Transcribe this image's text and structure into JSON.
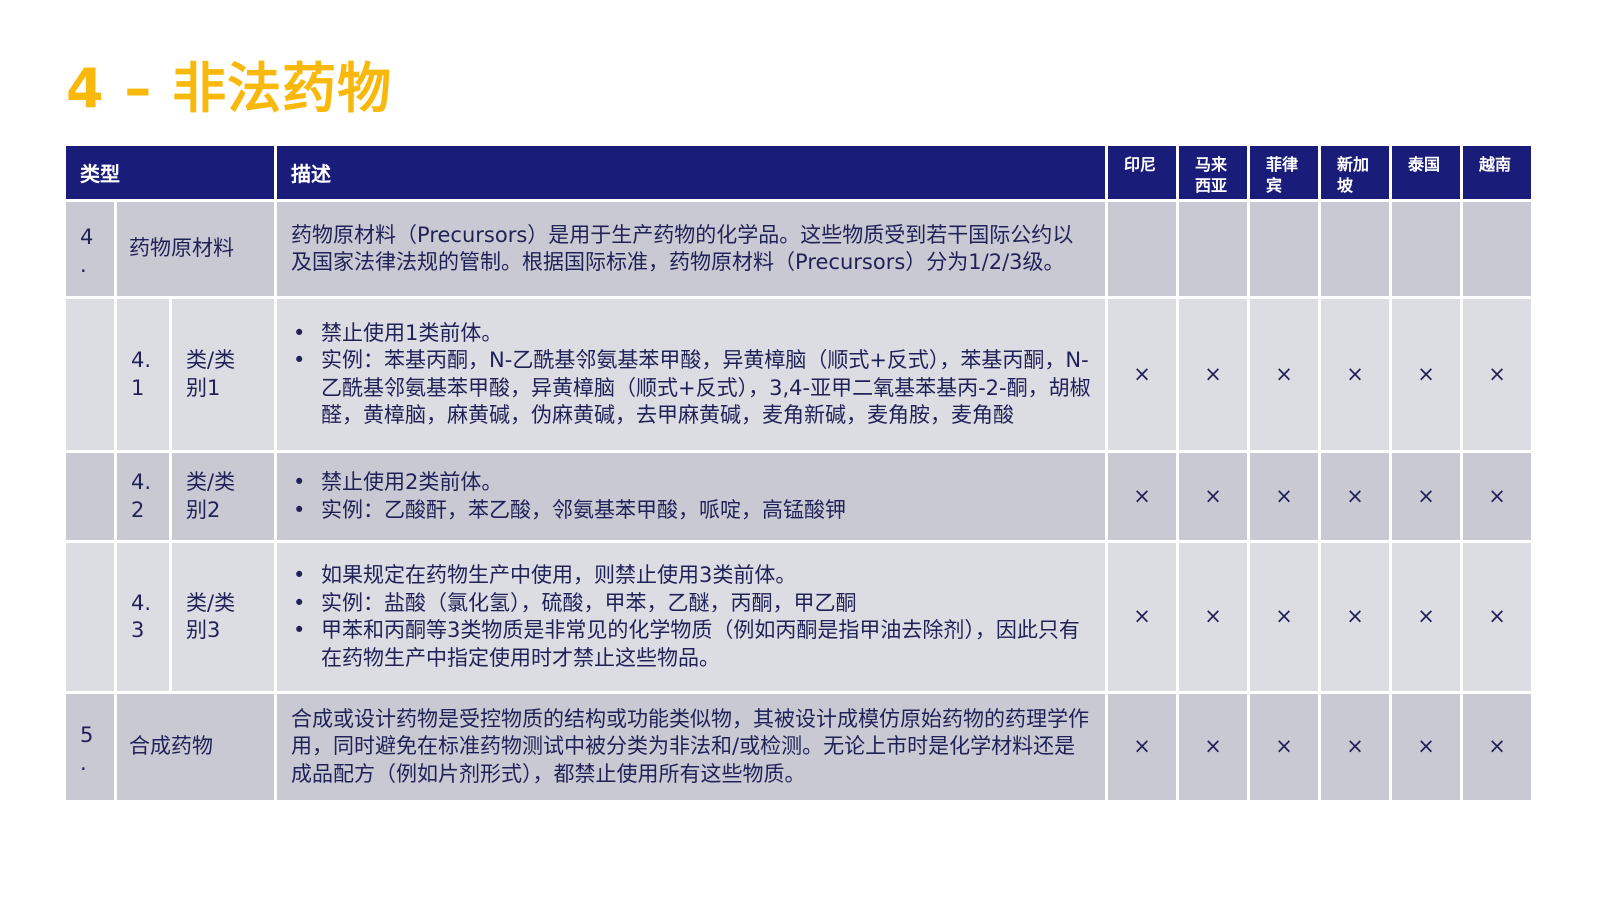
{
  "title": "4 – 非法药物",
  "header": {
    "type": "类型",
    "description": "描述",
    "countries": [
      "印尼",
      "马来\n西亚",
      "菲律\n宾",
      "新加\n坡",
      "泰国",
      "越南"
    ]
  },
  "rows": [
    {
      "number": "4\n.",
      "name": "药物原材料",
      "description": "药物原材料（Precursors）是用于生产药物的化学品。这些物质受到若干国际公约以及国家法律法规的管制。根据国际标准，药物原材料（Precursors）分为1/2/3级。",
      "marks": [
        "",
        "",
        "",
        "",
        "",
        ""
      ]
    },
    {
      "sub_number": "4.\n1",
      "sub_name": "类/类\n别1",
      "bullets": [
        "禁止使用1类前体。",
        "实例：苯基丙酮，N-乙酰基邻氨基苯甲酸，异黄樟脑（顺式+反式），苯基丙酮，N-乙酰基邻氨基苯甲酸，异黄樟脑（顺式+反式），3,4-亚甲二氧基苯基丙-2-酮，胡椒醛，黄樟脑，麻黄碱，伪麻黄碱，去甲麻黄碱，麦角新碱，麦角胺，麦角酸"
      ],
      "marks": [
        "×",
        "×",
        "×",
        "×",
        "×",
        "×"
      ]
    },
    {
      "sub_number": "4.\n2",
      "sub_name": "类/类\n别2",
      "bullets": [
        "禁止使用2类前体。",
        "实例：乙酸酐，苯乙酸，邻氨基苯甲酸，哌啶，高锰酸钾"
      ],
      "marks": [
        "×",
        "×",
        "×",
        "×",
        "×",
        "×"
      ]
    },
    {
      "sub_number": "4.\n3",
      "sub_name": "类/类\n别3",
      "bullets": [
        "如果规定在药物生产中使用，则禁止使用3类前体。",
        "实例：盐酸（氯化氢），硫酸，甲苯，乙醚，丙酮，甲乙酮",
        "甲苯和丙酮等3类物质是非常见的化学物质（例如丙酮是指甲油去除剂），因此只有在药物生产中指定使用时才禁止这些物品。"
      ],
      "marks": [
        "×",
        "×",
        "×",
        "×",
        "×",
        "×"
      ]
    },
    {
      "number": "5\n.",
      "name": "合成药物",
      "description": "合成或设计药物是受控物质的结构或功能类似物，其被设计成模仿原始药物的药理学作用，同时避免在标准药物测试中被分类为非法和/或检测。无论上市时是化学材料还是成品配方（例如片剂形式），都禁止使用所有这些物质。",
      "marks": [
        "×",
        "×",
        "×",
        "×",
        "×",
        "×"
      ]
    }
  ]
}
